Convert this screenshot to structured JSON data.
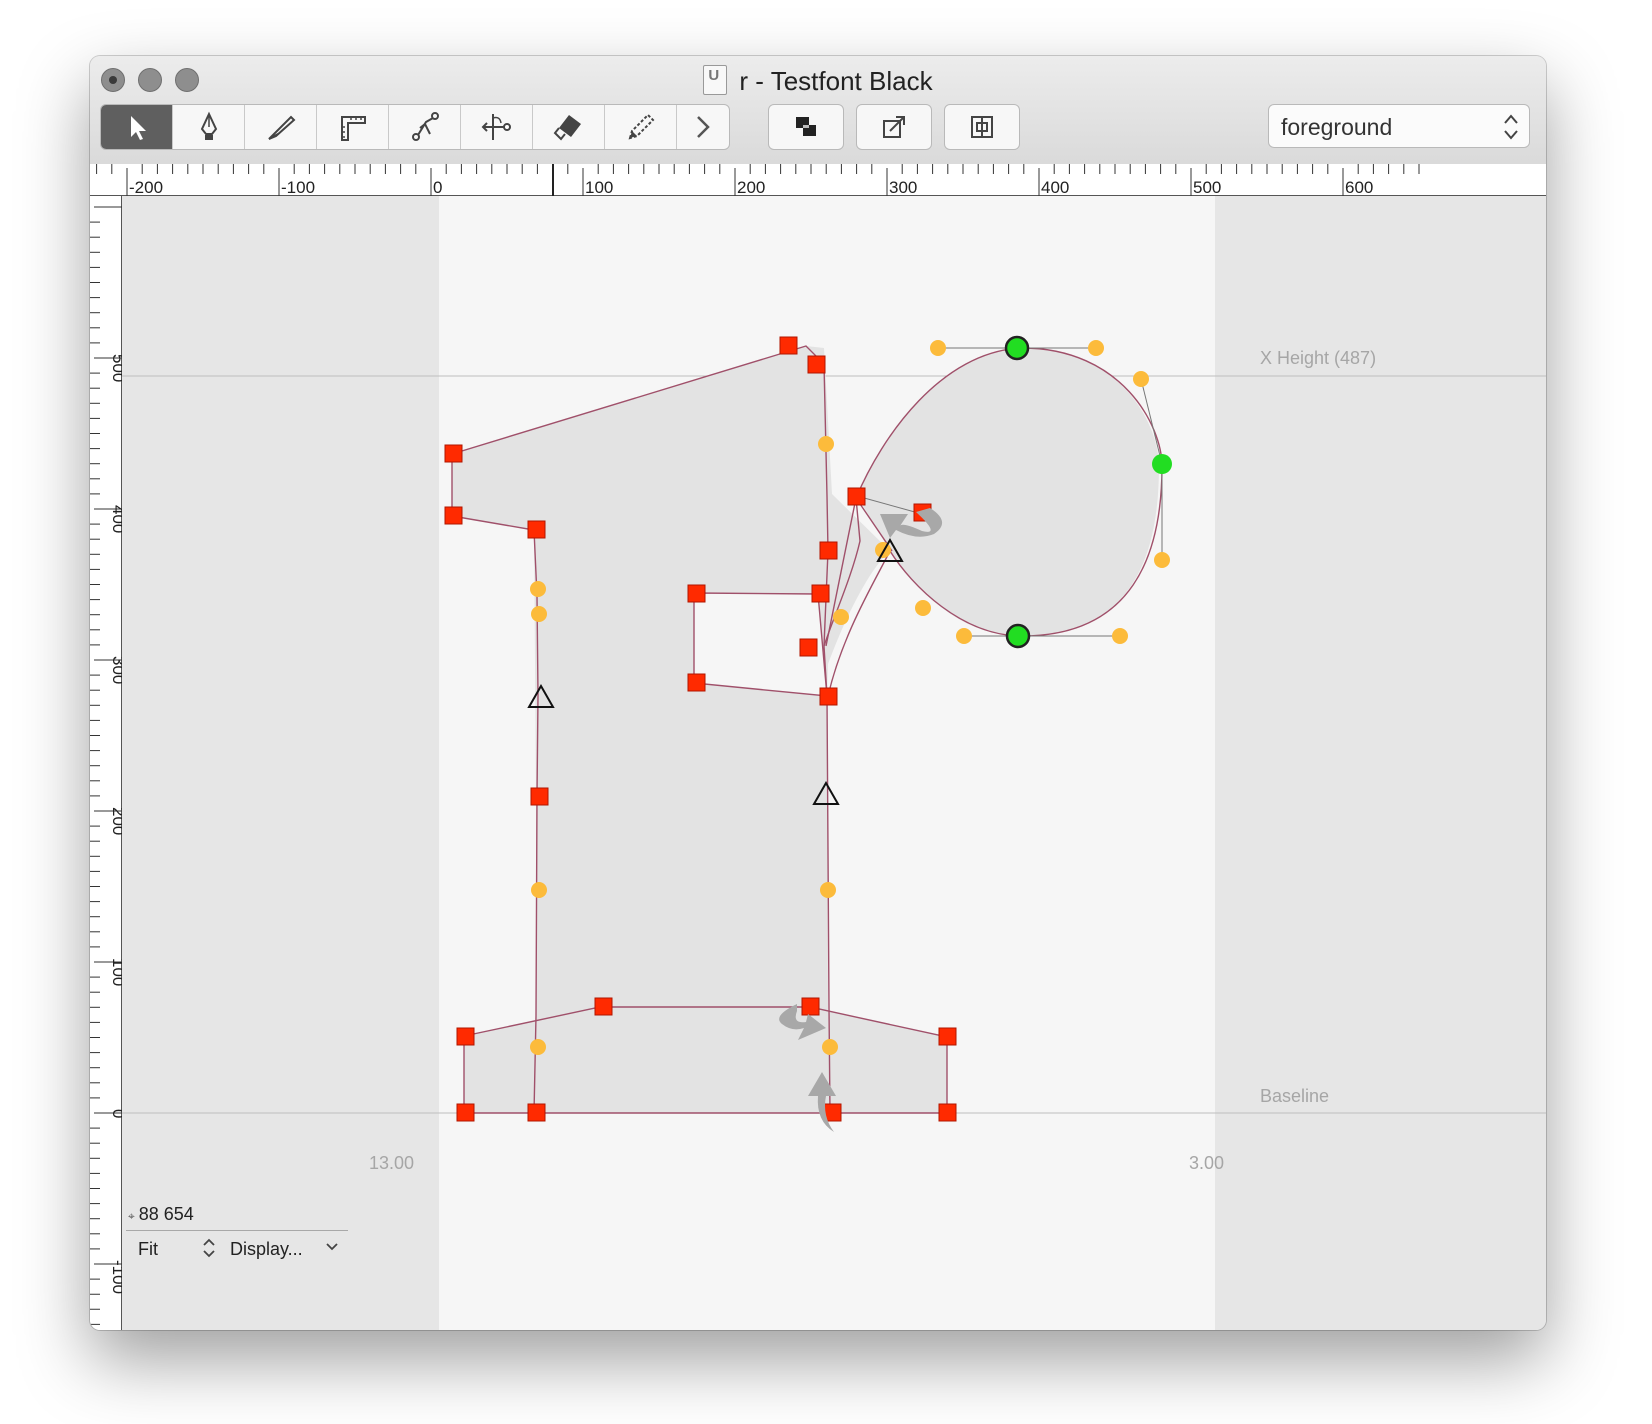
{
  "window": {
    "title": "r - Testfont Black"
  },
  "toolbar": {
    "tools": [
      {
        "name": "select-tool"
      },
      {
        "name": "pen-tool"
      },
      {
        "name": "knife-tool"
      },
      {
        "name": "measure-tool"
      },
      {
        "name": "bender-tool"
      },
      {
        "name": "sidebearing-tool"
      },
      {
        "name": "eraser-tool"
      },
      {
        "name": "pencil-tool"
      },
      {
        "name": "more-tools"
      }
    ],
    "active_tool": "select-tool",
    "layer": "foreground"
  },
  "rulers": {
    "horizontal_labels": [
      "-200",
      "-100",
      "0",
      "100",
      "200",
      "300",
      "400",
      "500",
      "600"
    ],
    "vertical_labels": [
      "500",
      "400",
      "300",
      "200",
      "100",
      "0",
      "-100"
    ]
  },
  "guides": {
    "x_height": "X Height (487)",
    "baseline": "Baseline",
    "left_margin": "13.00",
    "right_margin": "3.00"
  },
  "status": {
    "coordinates": "88 654",
    "zoom": "Fit",
    "display": "Display..."
  },
  "colors": {
    "on_curve_point": "#ff2a00",
    "off_curve_point": "#fcbb3b",
    "smooth_point": "#22dd22",
    "outline": "#a0506a"
  }
}
